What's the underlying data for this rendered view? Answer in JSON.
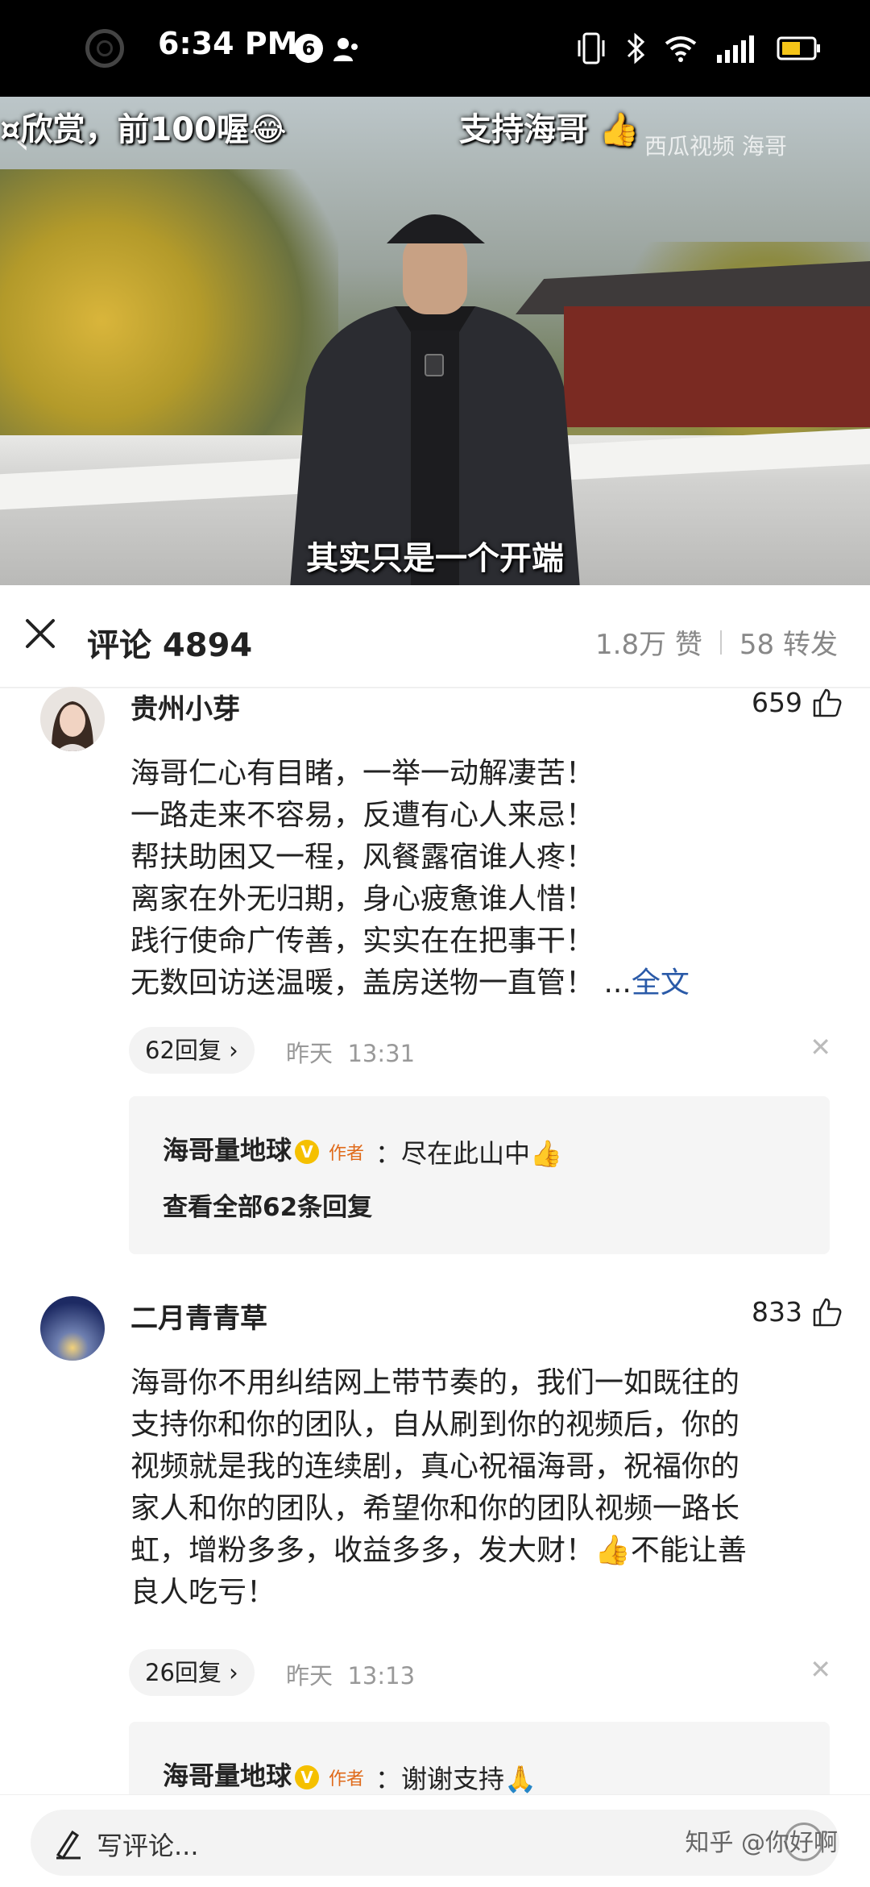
{
  "status_bar": {
    "time": "6:34 PM",
    "notification_count": "6"
  },
  "video": {
    "overlay_left": "¤欣赏，前100喔😂",
    "overlay_center": "支持海哥 👍",
    "watermark": "西瓜视频 海哥",
    "subtitle": "其实只是一个开端"
  },
  "comments_header": {
    "title": "评论 4894",
    "likes_label": "1.8万 赞",
    "shares_label": "58 转发"
  },
  "comments": [
    {
      "username": "贵州小芽",
      "likes": "659",
      "lines": [
        "海哥仁心有目睹，一举一动解凄苦！",
        "一路走来不容易，反遭有心人来忌！",
        "帮扶助困又一程，风餐露宿谁人疼！",
        "离家在外无归期，身心疲惫谁人惜！",
        "践行使命广传善，实实在在把事干！",
        "无数回访送温暖，盖房送物一直管！"
      ],
      "ellipsis": "...",
      "full_text_link": "全文",
      "reply_count": "62回复",
      "date": "昨天",
      "time": "13:31",
      "reply": {
        "author": "海哥量地球",
        "author_tag": "作者",
        "text": "：尽在此山中👍",
        "see_all": "查看全部62条回复"
      }
    },
    {
      "username": "二月青青草",
      "likes": "833",
      "lines": [
        "海哥你不用纠结网上带节奏的，我们一如既往的",
        "支持你和你的团队，自从刷到你的视频后，你的",
        "视频就是我的连续剧，真心祝福海哥，祝福你的",
        "家人和你的团队，希望你和你的团队视频一路长",
        "虹，增粉多多，收益多多，发大财！👍不能让善",
        "良人吃亏！"
      ],
      "reply_count": "26回复",
      "date": "昨天",
      "time": "13:13",
      "reply": {
        "author": "海哥量地球",
        "author_tag": "作者",
        "text": "：谢谢支持🙏"
      }
    }
  ],
  "bottom": {
    "input_placeholder": "写评论...",
    "watermark": "知乎 @你好啊"
  },
  "colors": {
    "link": "#2a5aa8",
    "author_tag": "#e06a1a",
    "verified_badge": "#f5c000"
  },
  "icons": [
    "camera-icon",
    "person-icon",
    "vibrate-icon",
    "bluetooth-icon",
    "wifi-icon",
    "signal-icon",
    "battery-icon",
    "back-icon",
    "close-icon",
    "thumbs-up-icon",
    "chevron-right-icon",
    "dismiss-icon",
    "pen-icon",
    "emoji-icon"
  ]
}
